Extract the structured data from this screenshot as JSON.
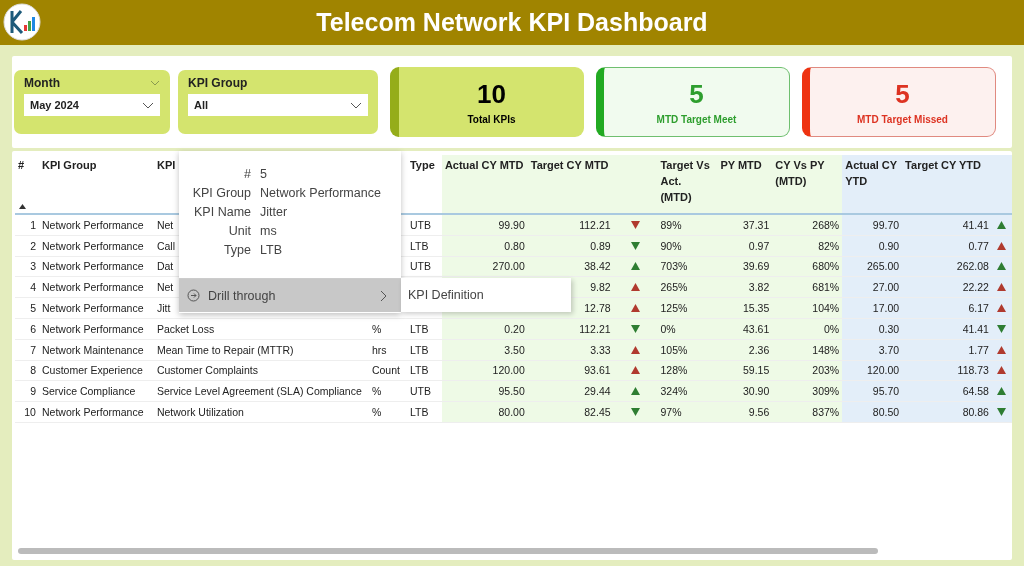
{
  "header": {
    "title": "Telecom Network KPI Dashboard"
  },
  "filters": [
    {
      "label": "Month",
      "value": "May 2024",
      "header_caret": true
    },
    {
      "label": "KPI Group",
      "value": "All",
      "header_caret": false
    }
  ],
  "cards": [
    {
      "kind": "total",
      "value": "10",
      "label": "Total KPIs"
    },
    {
      "kind": "meet",
      "value": "5",
      "label": "MTD Target Meet"
    },
    {
      "kind": "missed",
      "value": "5",
      "label": "MTD Target Missed"
    }
  ],
  "table": {
    "sort_ascending": true,
    "columns": [
      {
        "label": "#",
        "kind": "plain"
      },
      {
        "label": "KPI Group",
        "kind": "plain"
      },
      {
        "label": "KPI",
        "kind": "plain"
      },
      {
        "kind": "plain"
      },
      {
        "label": "Type",
        "kind": "plain"
      },
      {
        "label": "Actual CY MTD",
        "kind": "mtd"
      },
      {
        "label": "Target CY MTD",
        "kind": "mtd"
      },
      {
        "kind": "mtd"
      },
      {
        "label": "Target Vs Act. (MTD)",
        "kind": "mtd"
      },
      {
        "label": "PY MTD",
        "kind": "mtd"
      },
      {
        "label": "CY Vs PY (MTD)",
        "kind": "mtd"
      },
      {
        "label": "Actual CY YTD",
        "kind": "ytd"
      },
      {
        "label": "Target CY YTD",
        "kind": "ytd"
      },
      {
        "kind": "ytd"
      }
    ],
    "rows": [
      {
        "num": "1",
        "group": "Network Performance",
        "name": "Net",
        "unit": null,
        "type": "UTB",
        "actual_mtd": "99.90",
        "target_mtd": "112.21",
        "mtd_up": false,
        "mtd_good": false,
        "target_vs_act": "89%",
        "py_mtd": "37.31",
        "cy_vs_py": "268%",
        "actual_ytd": "99.70",
        "target_ytd": "41.41",
        "ytd_up": true,
        "ytd_good": true
      },
      {
        "num": "2",
        "group": "Network Performance",
        "name": "Call",
        "unit": null,
        "type": "LTB",
        "actual_mtd": "0.80",
        "target_mtd": "0.89",
        "mtd_up": false,
        "mtd_good": true,
        "target_vs_act": "90%",
        "py_mtd": "0.97",
        "cy_vs_py": "82%",
        "actual_ytd": "0.90",
        "target_ytd": "0.77",
        "ytd_up": true,
        "ytd_good": false
      },
      {
        "num": "3",
        "group": "Network Performance",
        "name": "Dat",
        "unit": null,
        "type": "UTB",
        "actual_mtd": "270.00",
        "target_mtd": "38.42",
        "mtd_up": true,
        "mtd_good": true,
        "target_vs_act": "703%",
        "py_mtd": "39.69",
        "cy_vs_py": "680%",
        "actual_ytd": "265.00",
        "target_ytd": "262.08",
        "ytd_up": true,
        "ytd_good": true
      },
      {
        "num": "4",
        "group": "Network Performance",
        "name": "Net",
        "unit": null,
        "type": null,
        "actual_mtd": null,
        "target_mtd": "9.82",
        "mtd_up": true,
        "mtd_good": false,
        "target_vs_act": "265%",
        "py_mtd": "3.82",
        "cy_vs_py": "681%",
        "actual_ytd": "27.00",
        "target_ytd": "22.22",
        "ytd_up": true,
        "ytd_good": false
      },
      {
        "num": "5",
        "group": "Network Performance",
        "name": "Jitt",
        "unit": null,
        "type": null,
        "actual_mtd": null,
        "target_mtd": "12.78",
        "mtd_up": true,
        "mtd_good": false,
        "target_vs_act": "125%",
        "py_mtd": "15.35",
        "cy_vs_py": "104%",
        "actual_ytd": "17.00",
        "target_ytd": "6.17",
        "ytd_up": true,
        "ytd_good": false
      },
      {
        "num": "6",
        "group": "Network Performance",
        "name": "Packet Loss",
        "unit": "%",
        "type": "LTB",
        "actual_mtd": "0.20",
        "target_mtd": "112.21",
        "mtd_up": false,
        "mtd_good": true,
        "target_vs_act": "0%",
        "py_mtd": "43.61",
        "cy_vs_py": "0%",
        "actual_ytd": "0.30",
        "target_ytd": "41.41",
        "ytd_up": false,
        "ytd_good": true
      },
      {
        "num": "7",
        "group": "Network Maintenance",
        "name": "Mean Time to Repair (MTTR)",
        "unit": "hrs",
        "type": "LTB",
        "actual_mtd": "3.50",
        "target_mtd": "3.33",
        "mtd_up": true,
        "mtd_good": false,
        "target_vs_act": "105%",
        "py_mtd": "2.36",
        "cy_vs_py": "148%",
        "actual_ytd": "3.70",
        "target_ytd": "1.77",
        "ytd_up": true,
        "ytd_good": false
      },
      {
        "num": "8",
        "group": "Customer Experience",
        "name": "Customer Complaints",
        "unit": "Count",
        "type": "LTB",
        "actual_mtd": "120.00",
        "target_mtd": "93.61",
        "mtd_up": true,
        "mtd_good": false,
        "target_vs_act": "128%",
        "py_mtd": "59.15",
        "cy_vs_py": "203%",
        "actual_ytd": "120.00",
        "target_ytd": "118.73",
        "ytd_up": true,
        "ytd_good": false
      },
      {
        "num": "9",
        "group": "Service Compliance",
        "name": "Service Level Agreement (SLA) Compliance",
        "unit": "%",
        "type": "UTB",
        "actual_mtd": "95.50",
        "target_mtd": "29.44",
        "mtd_up": true,
        "mtd_good": true,
        "target_vs_act": "324%",
        "py_mtd": "30.90",
        "cy_vs_py": "309%",
        "actual_ytd": "95.70",
        "target_ytd": "64.58",
        "ytd_up": true,
        "ytd_good": true
      },
      {
        "num": "10",
        "group": "Network Performance",
        "name": "Network Utilization",
        "unit": "%",
        "type": "LTB",
        "actual_mtd": "80.00",
        "target_mtd": "82.45",
        "mtd_up": false,
        "mtd_good": true,
        "target_vs_act": "97%",
        "py_mtd": "9.56",
        "cy_vs_py": "837%",
        "actual_ytd": "80.50",
        "target_ytd": "80.86",
        "ytd_up": false,
        "ytd_good": true
      }
    ]
  },
  "tooltip": {
    "fields": [
      {
        "label": "#",
        "value": "5"
      },
      {
        "label": "KPI Group",
        "value": "Network Performance"
      },
      {
        "label": "KPI Name",
        "value": "Jitter"
      },
      {
        "label": "Unit",
        "value": "ms"
      },
      {
        "label": "Type",
        "value": "LTB"
      }
    ],
    "menu_item": "Drill through",
    "submenu": [
      "KPI Definition"
    ]
  }
}
